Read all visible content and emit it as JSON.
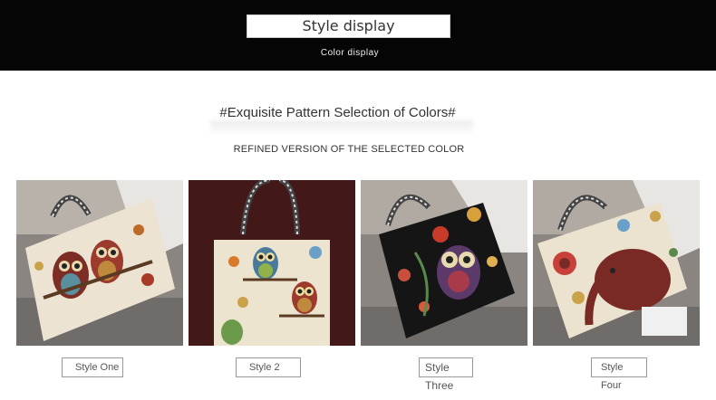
{
  "header": {
    "title": "Style display",
    "subtitle": "Color display"
  },
  "section": {
    "heading": "#Exquisite Pattern Selection of Colors#",
    "subheading": "REFINED VERSION OF THE SELECTED COLOR"
  },
  "products": [
    {
      "label": "Style One",
      "image": "owl-pair-tote-beige"
    },
    {
      "label": "Style 2",
      "image": "two-owls-tote-cream"
    },
    {
      "label": "Style Three",
      "image": "owl-flower-tote-black"
    },
    {
      "label": "Style Four",
      "image": "elephant-tote-beige"
    }
  ],
  "colors": {
    "topbar": "#050505",
    "page": "#ffffff"
  }
}
